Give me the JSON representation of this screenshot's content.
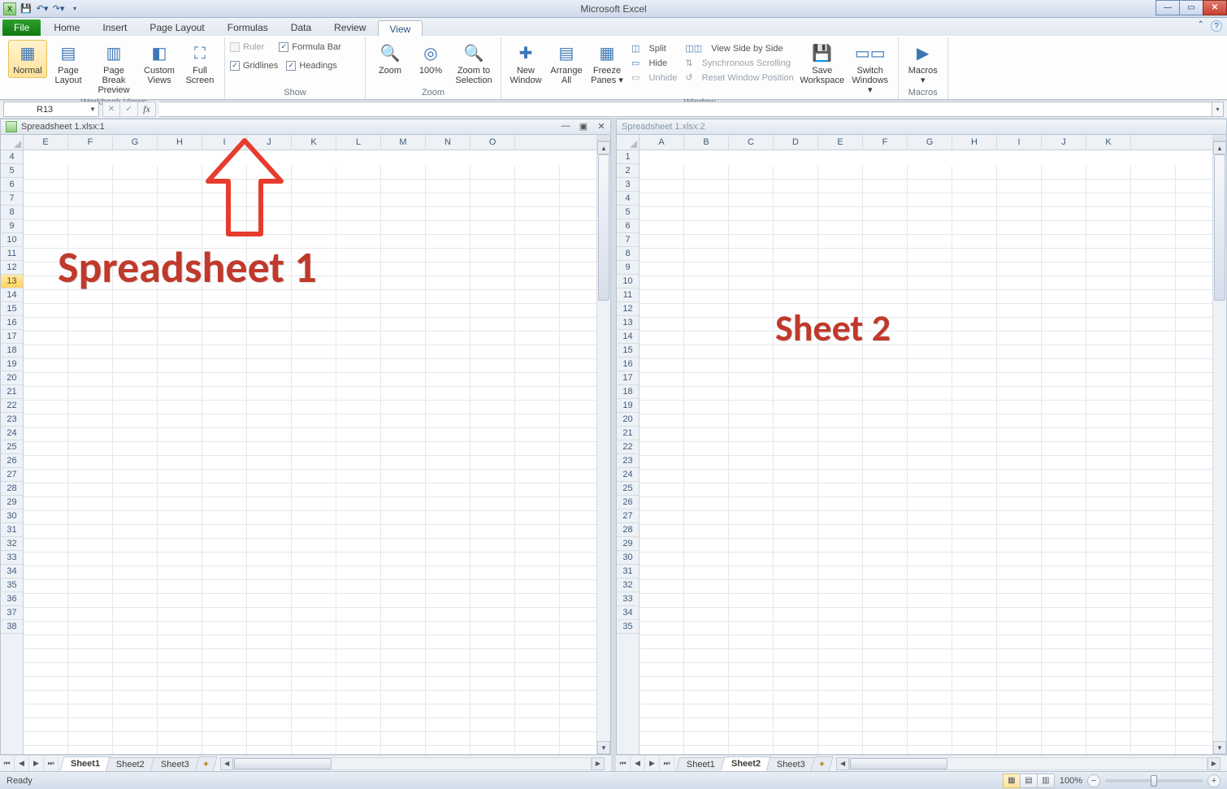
{
  "app": {
    "title": "Microsoft Excel"
  },
  "qat": {
    "undo": "↶",
    "redo": "↷",
    "save": "💾"
  },
  "tabs": {
    "file": "File",
    "items": [
      "Home",
      "Insert",
      "Page Layout",
      "Formulas",
      "Data",
      "Review",
      "View"
    ],
    "activeIndex": 6
  },
  "ribbon": {
    "views": {
      "normal": "Normal",
      "pageLayout": "Page Layout",
      "pageBreak": "Page Break Preview",
      "custom": "Custom Views",
      "full": "Full Screen",
      "group": "Workbook Views"
    },
    "show": {
      "ruler": "Ruler",
      "formulaBar": "Formula Bar",
      "gridlines": "Gridlines",
      "headings": "Headings",
      "group": "Show"
    },
    "zoom": {
      "zoom": "Zoom",
      "z100": "100%",
      "zsel": "Zoom to Selection",
      "group": "Zoom"
    },
    "window": {
      "newWin": "New Window",
      "arrange": "Arrange All",
      "freeze": "Freeze Panes ▾",
      "split": "Split",
      "hide": "Hide",
      "unhide": "Unhide",
      "sbs": "View Side by Side",
      "sync": "Synchronous Scrolling",
      "reset": "Reset Window Position",
      "saveWs": "Save Workspace",
      "switch": "Switch Windows ▾",
      "group": "Window"
    },
    "macros": {
      "macros": "Macros ▾",
      "group": "Macros"
    }
  },
  "namebox": "R13",
  "fx": "fx",
  "panes": {
    "left": {
      "title": "Spreadsheet 1.xlsx:1",
      "cols": [
        "E",
        "F",
        "G",
        "H",
        "I",
        "J",
        "K",
        "L",
        "M",
        "N",
        "O"
      ],
      "rowStart": 4,
      "rowEnd": 38,
      "selectedRow": 13,
      "tabs": [
        "Sheet1",
        "Sheet2",
        "Sheet3"
      ],
      "activeTab": 0,
      "overlay": "Spreadsheet 1"
    },
    "right": {
      "title": "Spreadsheet 1.xlsx:2",
      "cols": [
        "A",
        "B",
        "C",
        "D",
        "E",
        "F",
        "G",
        "H",
        "I",
        "J",
        "K"
      ],
      "rowStart": 1,
      "rowEnd": 35,
      "tabs": [
        "Sheet1",
        "Sheet2",
        "Sheet3"
      ],
      "activeTab": 1,
      "overlay": "Sheet 2"
    }
  },
  "status": {
    "ready": "Ready",
    "zoom": "100%"
  }
}
